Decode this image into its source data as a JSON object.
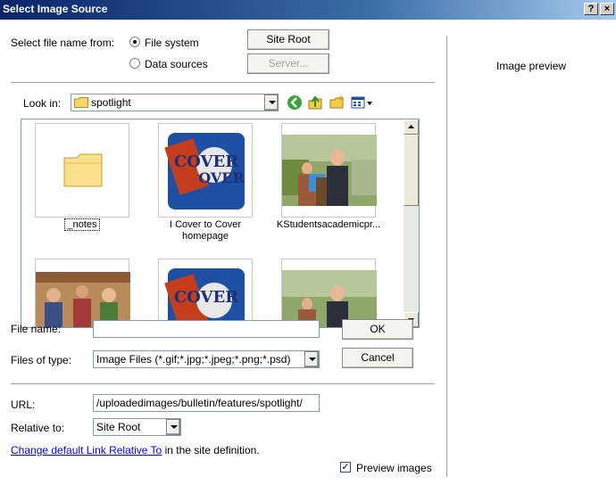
{
  "window": {
    "title": "Select Image Source",
    "help_label": "?",
    "close_label": "×"
  },
  "source": {
    "label": "Select file name from:",
    "option_file_system": "File system",
    "option_data_sources": "Data sources",
    "selected": "File system",
    "site_root_button": "Site Root",
    "server_button": "Server..."
  },
  "preview": {
    "label": "Image preview"
  },
  "look_in": {
    "label": "Look in:",
    "value": "spotlight"
  },
  "toolbar_icons": [
    "back-icon",
    "up-folder-icon",
    "new-folder-icon",
    "view-menu-icon"
  ],
  "files": [
    {
      "name": "_notes",
      "type": "folder"
    },
    {
      "name": "I Cover to Cover homepage",
      "type": "image"
    },
    {
      "name": "KStudentsacademicpr...",
      "type": "image"
    },
    {
      "name": "",
      "type": "image"
    },
    {
      "name": "",
      "type": "image"
    },
    {
      "name": "",
      "type": "image"
    }
  ],
  "file_name": {
    "label": "File name:",
    "value": ""
  },
  "files_of_type": {
    "label": "Files of type:",
    "value": "Image Files (*.gif;*.jpg;*.jpeg;*.png;*.psd)"
  },
  "ok_button": "OK",
  "cancel_button": "Cancel",
  "url": {
    "label": "URL:",
    "value": "/uploadedimages/bulletin/features/spotlight/"
  },
  "relative_to": {
    "label": "Relative to:",
    "value": "Site Root"
  },
  "footer": {
    "link_text": "Change default Link Relative To",
    "suffix_text": " in the site definition."
  },
  "preview_images": {
    "label": "Preview images",
    "checked": true
  },
  "colors": {
    "title_bar": "#0a246a",
    "link": "#0000ee",
    "input_border": "#7f9db9"
  }
}
